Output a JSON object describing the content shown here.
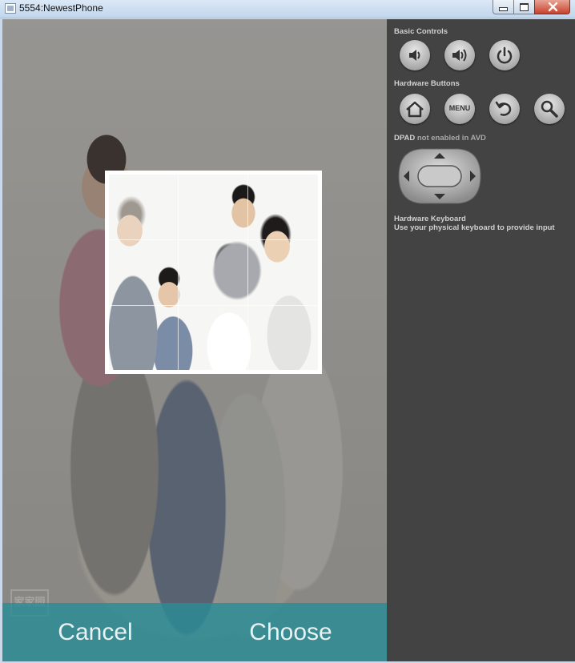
{
  "window": {
    "title": "5554:NewestPhone"
  },
  "screen": {
    "crop_grid": {
      "columns": 3,
      "rows": 3
    },
    "watermark_text": "家家园",
    "actions": {
      "cancel_label": "Cancel",
      "choose_label": "Choose"
    }
  },
  "panel": {
    "basic_controls_label": "Basic Controls",
    "basic_controls": [
      {
        "icon": "volume-down-icon"
      },
      {
        "icon": "volume-up-icon"
      },
      {
        "icon": "power-icon"
      }
    ],
    "hardware_buttons_label": "Hardware Buttons",
    "hardware_buttons": [
      {
        "icon": "home-icon"
      },
      {
        "icon": "menu-icon",
        "label": "MENU"
      },
      {
        "icon": "back-icon"
      },
      {
        "icon": "search-icon"
      }
    ],
    "dpad_label": "DPAD",
    "dpad_note": "not enabled in AVD",
    "keyboard_label": "Hardware Keyboard",
    "keyboard_note": "Use your physical keyboard to provide input"
  },
  "colors": {
    "action_bar": "#2a8c96",
    "panel_bg": "#434343"
  }
}
